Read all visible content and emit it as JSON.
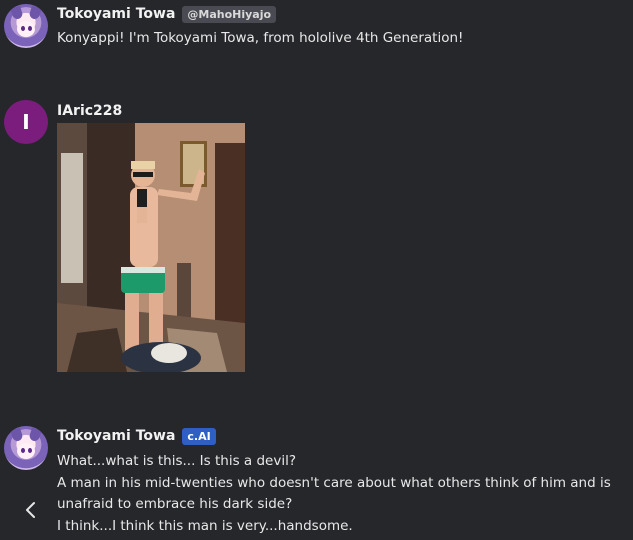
{
  "messages": [
    {
      "author": "Tokoyami Towa",
      "handle": "@MahoHiyajo",
      "text": "Konyappi! I'm Tokoyami Towa, from hololive 4th Generation!"
    },
    {
      "author": "IAric228",
      "avatar_letter": "I",
      "avatar_color": "#7a1d7d",
      "image": "mirror-selfie-photo"
    },
    {
      "author": "Tokoyami Towa",
      "badge": "c.AI",
      "badge_color": "#2f5fc2",
      "lines": [
        "What...what is this... Is this a devil?",
        "A man in his mid-twenties who doesn't care about what others think of him and is unafraid to embrace his dark side?",
        "I think...I think this man is very...handsome."
      ]
    }
  ],
  "icons": {
    "back": "chevron-left-icon"
  }
}
